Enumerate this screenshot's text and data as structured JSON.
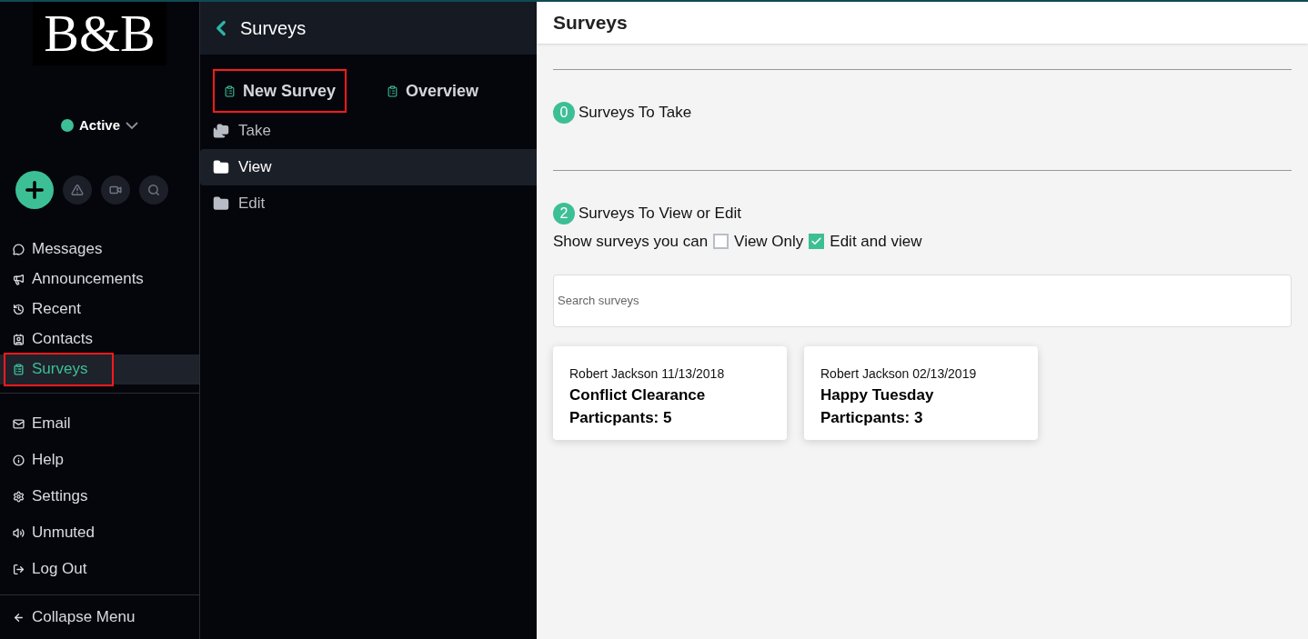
{
  "logo": "B&B",
  "status": {
    "label": "Active",
    "color": "#3dbf95"
  },
  "quick_actions": [
    {
      "kind": "add"
    },
    {
      "kind": "alert"
    },
    {
      "kind": "video"
    },
    {
      "kind": "search"
    }
  ],
  "nav": [
    {
      "label": "Messages",
      "selected": false,
      "highlighted": false
    },
    {
      "label": "Announcements",
      "selected": false,
      "highlighted": false
    },
    {
      "label": "Recent",
      "selected": false,
      "highlighted": false
    },
    {
      "label": "Contacts",
      "selected": false,
      "highlighted": false
    },
    {
      "label": "Surveys",
      "selected": true,
      "highlighted": true
    }
  ],
  "nav_secondary": [
    {
      "label": "Email"
    },
    {
      "label": "Help"
    },
    {
      "label": "Settings"
    },
    {
      "label": "Unmuted"
    },
    {
      "label": "Log Out"
    }
  ],
  "collapse": "Collapse Menu",
  "panel": {
    "title": "Surveys",
    "actions": [
      {
        "label": "New Survey",
        "highlighted": true
      },
      {
        "label": "Overview",
        "highlighted": false
      }
    ],
    "folders": [
      {
        "label": "Take",
        "selected": false
      },
      {
        "label": "View",
        "selected": true
      },
      {
        "label": "Edit",
        "selected": false
      }
    ]
  },
  "main": {
    "title": "Surveys",
    "sections": [
      {
        "count": "0",
        "title": "Surveys To Take"
      },
      {
        "count": "2",
        "title": "Surveys To View or Edit"
      }
    ],
    "filter": {
      "label": "Show surveys you can",
      "options": [
        {
          "label": "View Only",
          "checked": false
        },
        {
          "label": "Edit and view",
          "checked": true
        }
      ]
    },
    "search": {
      "placeholder": "Search surveys"
    },
    "cards": [
      {
        "meta": "Robert Jackson 11/13/2018",
        "title": "Conflict Clearance",
        "participants": "Particpants: 5"
      },
      {
        "meta": "Robert Jackson 02/13/2019",
        "title": "Happy Tuesday",
        "participants": "Particpants: 3"
      }
    ]
  }
}
